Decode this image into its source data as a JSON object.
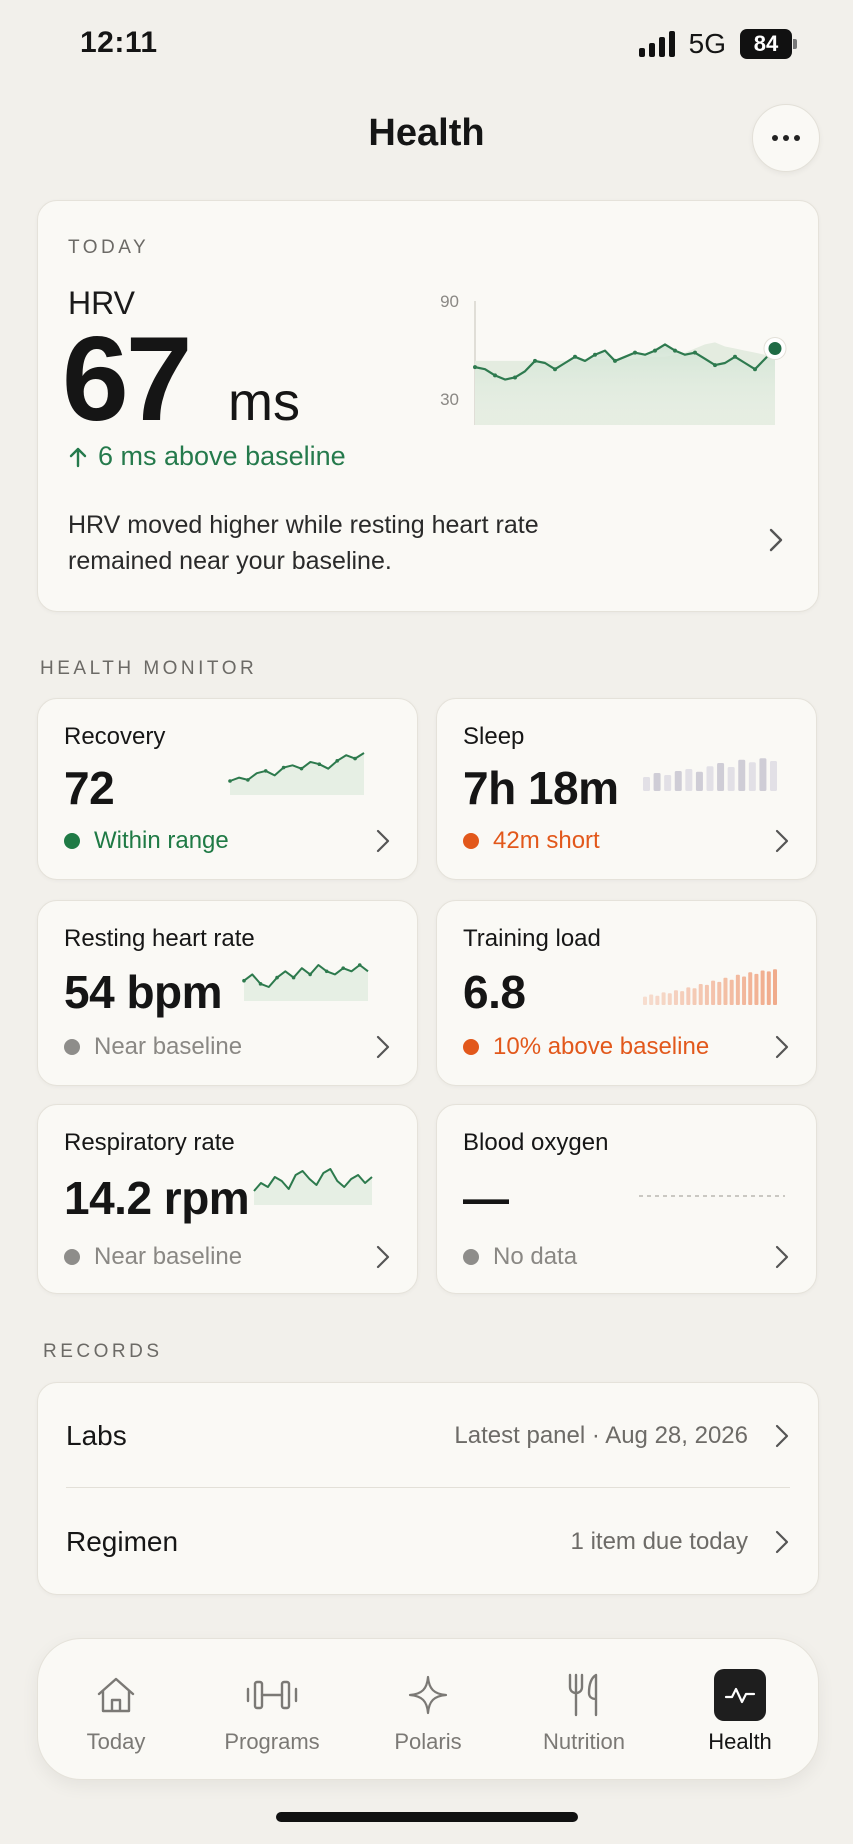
{
  "status_bar": {
    "time": "12:11",
    "network": "5G",
    "battery": "84"
  },
  "header": {
    "title": "Health"
  },
  "today": {
    "eyebrow": "TODAY",
    "metric_label": "HRV",
    "value": "67",
    "unit": "ms",
    "delta_text": "6 ms above baseline",
    "note": "HRV moved higher while resting heart rate remained near your baseline.",
    "chart": {
      "y_max_label": "90",
      "y_min_label": "30",
      "y_range": [
        30,
        90
      ],
      "values": [
        58,
        57,
        54,
        52,
        53,
        56,
        61,
        60,
        57,
        60,
        63,
        61,
        64,
        66,
        61,
        63,
        65,
        64,
        66,
        69,
        66,
        64,
        65,
        62,
        59,
        60,
        63,
        60,
        57,
        62,
        67
      ],
      "baseline_values": [
        61,
        61,
        61,
        61,
        61,
        61,
        61,
        61,
        61,
        61,
        61,
        61,
        62,
        62,
        62,
        62,
        62,
        63,
        63,
        63,
        64,
        65,
        67,
        69,
        70,
        68,
        67,
        66,
        65,
        64,
        64
      ],
      "line_color": "#2e7a4f"
    }
  },
  "health_monitor": {
    "label": "HEALTH MONITOR",
    "cards": [
      {
        "title": "Recovery",
        "value": "72",
        "status": "Within range",
        "status_color": "#1f7a45",
        "dot_color": "#1f7a45"
      },
      {
        "title": "Sleep",
        "value": "7h 18m",
        "status": "42m short",
        "status_color": "#e2581b",
        "dot_color": "#e2581b"
      },
      {
        "title": "Resting heart rate",
        "value": "54 bpm",
        "status": "Near baseline",
        "status_color": "#8a8884",
        "dot_color": "#8e8d8a"
      },
      {
        "title": "Training load",
        "value": "6.8",
        "status": "10% above baseline",
        "status_color": "#e2581b",
        "dot_color": "#e2581b"
      },
      {
        "title": "Respiratory rate",
        "value": "14.2 rpm",
        "status": "Near baseline",
        "status_color": "#8a8884",
        "dot_color": "#8e8d8a"
      },
      {
        "title": "Blood oxygen",
        "value": "—",
        "status": "No data",
        "status_color": "#8a8884",
        "dot_color": "#8e8d8a"
      }
    ],
    "recovery_trend": [
      35,
      38,
      36,
      42,
      44,
      40,
      47,
      49,
      46,
      52,
      50,
      46,
      53,
      58,
      55,
      60
    ],
    "sleep_bars": [
      0.35,
      0.45,
      0.4,
      0.5,
      0.55,
      0.48,
      0.62,
      0.7,
      0.6,
      0.78,
      0.72,
      0.82,
      0.75
    ],
    "resting_hr_trend": [
      52,
      54,
      51,
      50,
      53,
      55,
      53,
      56,
      54,
      57,
      55,
      54,
      56,
      55,
      57,
      55
    ],
    "training_bars": [
      0.2,
      0.25,
      0.22,
      0.3,
      0.28,
      0.35,
      0.33,
      0.42,
      0.4,
      0.5,
      0.48,
      0.58,
      0.55,
      0.65,
      0.6,
      0.72,
      0.68,
      0.78,
      0.74,
      0.82,
      0.8,
      0.85
    ],
    "resp_trend": [
      13.8,
      14.2,
      14.0,
      14.5,
      14.3,
      13.9,
      14.6,
      14.8,
      14.4,
      14.1,
      14.7,
      14.9,
      14.3,
      14.0,
      14.4,
      14.6,
      14.2,
      14.5
    ]
  },
  "records": {
    "label": "RECORDS",
    "rows": [
      {
        "label": "Labs",
        "meta": "Latest panel · Aug 28, 2026"
      },
      {
        "label": "Regimen",
        "meta": "1 item due today"
      }
    ]
  },
  "tabs": [
    {
      "label": "Today",
      "icon": "house-icon"
    },
    {
      "label": "Programs",
      "icon": "dumbbell-icon"
    },
    {
      "label": "Polaris",
      "icon": "sparkle-icon"
    },
    {
      "label": "Nutrition",
      "icon": "fork-knife-icon"
    },
    {
      "label": "Health",
      "icon": "pulse-icon",
      "active": true
    }
  ]
}
